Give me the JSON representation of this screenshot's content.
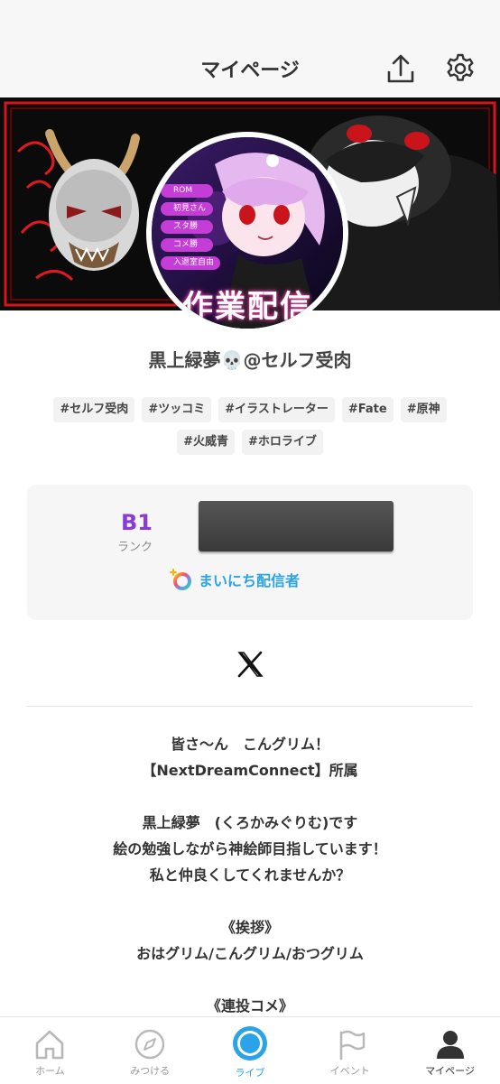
{
  "header": {
    "title": "マイページ"
  },
  "profile": {
    "name": "黒上緑夢💀@セルフ受肉"
  },
  "tags": [
    "#セルフ受肉",
    "#ツッコミ",
    "#イラストレーター",
    "#Fate",
    "#原神",
    "#火威青",
    "#ホロライブ"
  ],
  "rank": {
    "value": "B1",
    "label": "ランク"
  },
  "badge": {
    "label": "まいにち配信者"
  },
  "avatar": {
    "menu": [
      "ROM",
      "初見さん",
      "スタ勝",
      "コメ勝",
      "入退室自由"
    ],
    "caption": "作業配信"
  },
  "bio": [
    "皆さ〜ん　こんグリム！",
    "【NextDreamConnect】所属",
    "",
    "黒上緑夢　(くろかみぐりむ)です",
    "絵の勉強しながら神絵師目指しています！",
    "私と仲良くしてくれませんか？",
    "",
    "《挨拶》",
    "おはグリム/こんグリム/おつグリム",
    "",
    "《連投コメ》"
  ],
  "tabbar": {
    "items": [
      "ホーム",
      "みつける",
      "ライブ",
      "イベント",
      "マイページ"
    ]
  },
  "colors": {
    "accent": "#2aa3e8",
    "rank": "#8a3ad8",
    "banner_red": "#d4161b"
  }
}
